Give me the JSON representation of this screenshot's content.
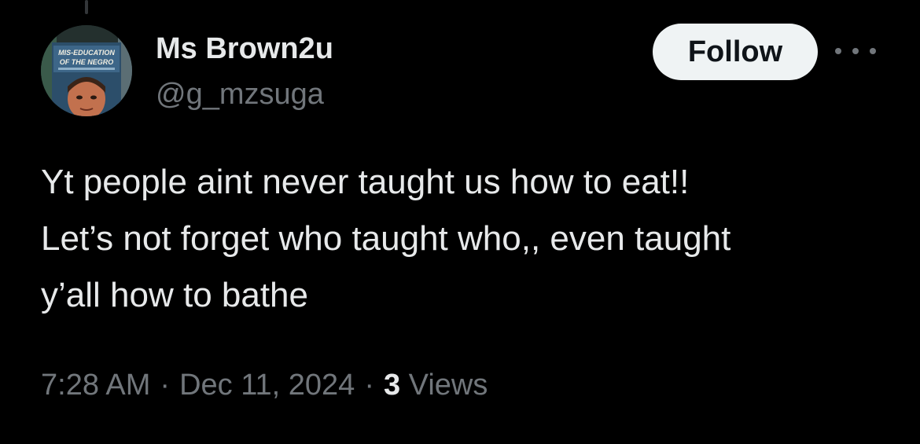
{
  "colors": {
    "background": "#000000",
    "primary_text": "#e7e9ea",
    "secondary_text": "#71767b",
    "follow_bg": "#eff3f4",
    "follow_text": "#0f1419"
  },
  "author": {
    "display_name": "Ms Brown2u",
    "handle": "@g_mzsuga",
    "avatar_text": {
      "line1": "MIS-EDUCATION",
      "line2": "OF THE NEGRO"
    }
  },
  "actions": {
    "follow_label": "Follow",
    "more_icon": "more-horizontal-icon"
  },
  "tweet": {
    "lines": [
      "Yt people aint never taught us how to eat!!",
      "Let’s not forget who taught who,, even taught",
      "y’all how to bathe"
    ]
  },
  "meta": {
    "time": "7:28 AM",
    "separator": "·",
    "date": "Dec 11, 2024",
    "views_count": "3",
    "views_label": "Views"
  }
}
